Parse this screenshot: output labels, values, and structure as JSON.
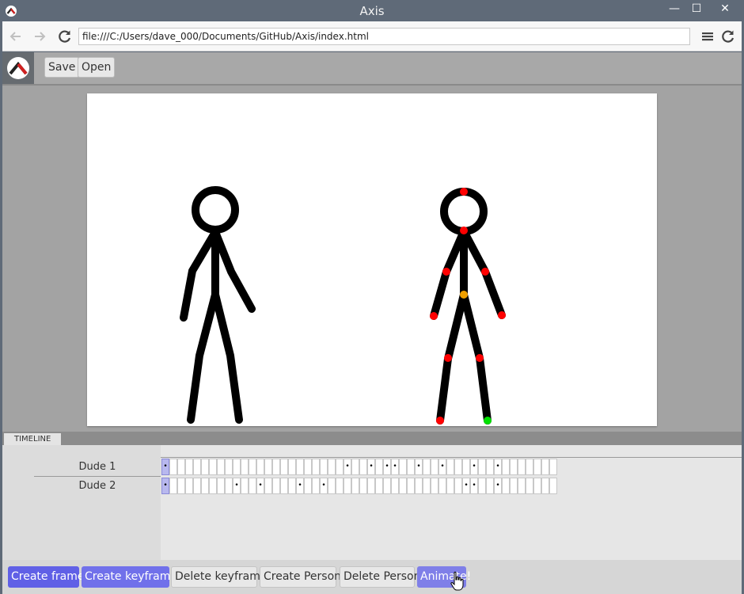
{
  "window": {
    "title": "Axis",
    "minimize_glyph": "—",
    "maximize_glyph": "☐",
    "close_glyph": "✕"
  },
  "browser": {
    "url": "file:///C:/Users/dave_000/Documents/GitHub/Axis/index.html",
    "back_icon": "arrow-left-icon",
    "forward_icon": "arrow-right-icon",
    "reload_icon": "reload-icon",
    "menu_icon": "hamburger-menu-icon"
  },
  "toolbar": {
    "save_label": "Save",
    "open_label": "Open"
  },
  "timeline": {
    "tab_label": "TIMELINE",
    "frame_count": 50,
    "tracks": [
      {
        "name": "Dude 1",
        "keyframes": [
          0,
          23,
          26,
          28,
          29,
          32,
          35,
          39,
          42
        ]
      },
      {
        "name": "Dude 2",
        "keyframes": [
          0,
          9,
          12,
          17,
          20,
          38,
          39,
          42
        ]
      }
    ],
    "selected_frame": 0
  },
  "actions": {
    "create_frame": "Create frame",
    "create_keyframe": "Create keyframe",
    "delete_keyframe": "Delete keyframe",
    "create_person": "Create Person",
    "delete_person": "Delete Person",
    "animate": "Animate!"
  },
  "colors": {
    "accent": "#6060e6",
    "joint": "#ff0000",
    "hip_joint": "#f0a000",
    "root_joint": "#00e000"
  }
}
